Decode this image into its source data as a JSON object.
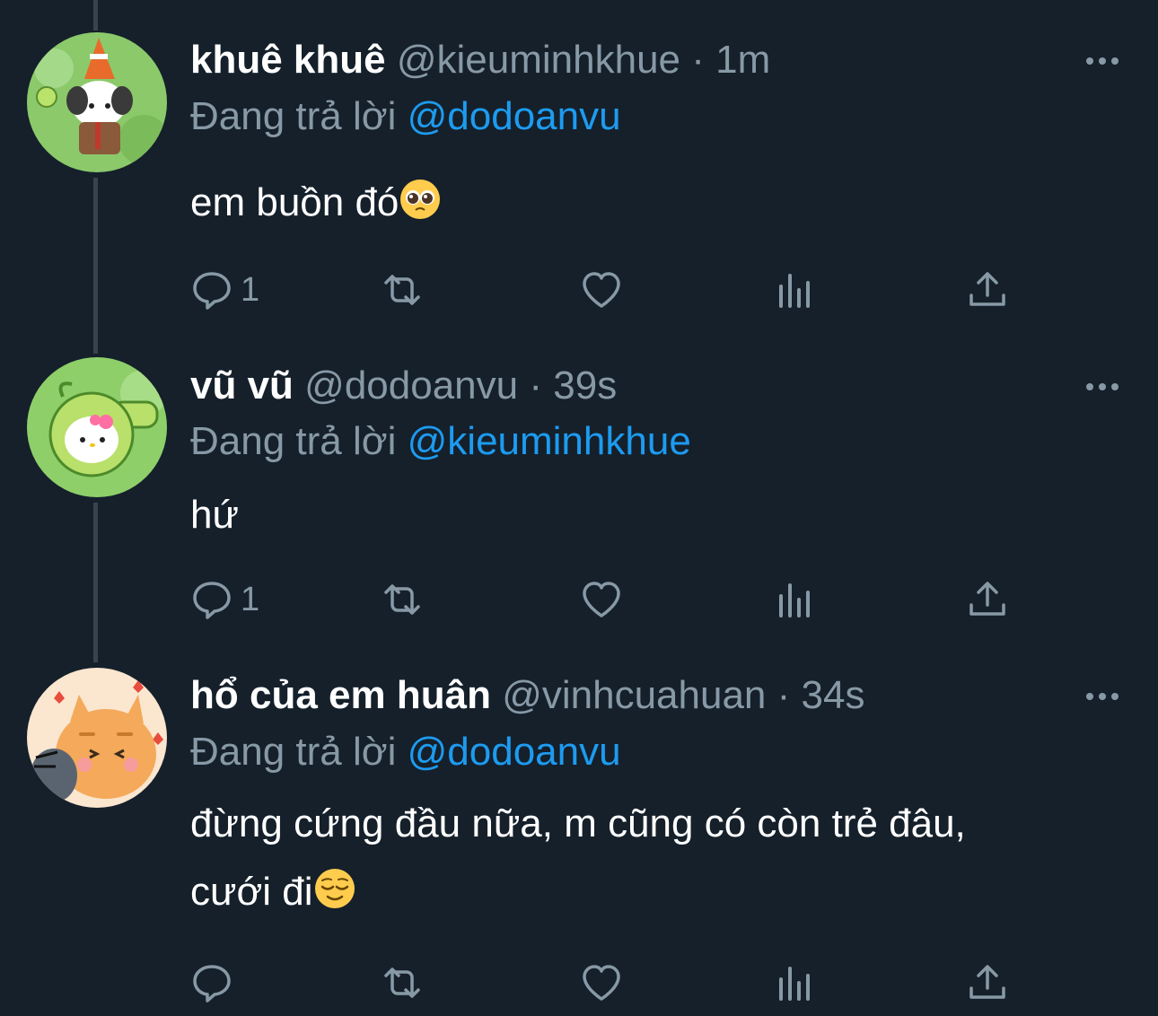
{
  "tweets": [
    {
      "name": "khuê khuê",
      "handle": "@kieuminhkhue",
      "separator": "·",
      "time": "1m",
      "replying_label": "Đang trả lời",
      "replying_to": "@dodoanvu",
      "text": "em buồn đó",
      "text_emoji": "pleading-face",
      "avatar": "pochacco-cone-avatar",
      "actions": {
        "reply_count": "1",
        "retweet_count": "",
        "like_count": ""
      }
    },
    {
      "name": "vũ vũ",
      "handle": "@dodoanvu",
      "separator": "·",
      "time": "39s",
      "replying_label": "Đang trả lời",
      "replying_to": "@kieuminhkhue",
      "text": "hứ",
      "avatar": "hello-kitty-peashooter-avatar",
      "actions": {
        "reply_count": "1",
        "retweet_count": "",
        "like_count": ""
      }
    },
    {
      "name": "hổ của em huân",
      "handle": "@vinhcuahuan",
      "separator": "·",
      "time": "34s",
      "replying_label": "Đang trả lời",
      "replying_to": "@dodoanvu",
      "text": "đừng cứng đầu nữa, m cũng có còn trẻ đâu, cưới đi",
      "text_emoji": "relieved-face",
      "avatar": "orange-cat-avatar",
      "actions": {
        "reply_count": "",
        "retweet_count": "",
        "like_count": ""
      }
    }
  ],
  "colors": {
    "background": "#15202b",
    "secondary_text": "#8899a6",
    "mention": "#1d9bf0",
    "thread_line": "#38444d"
  }
}
